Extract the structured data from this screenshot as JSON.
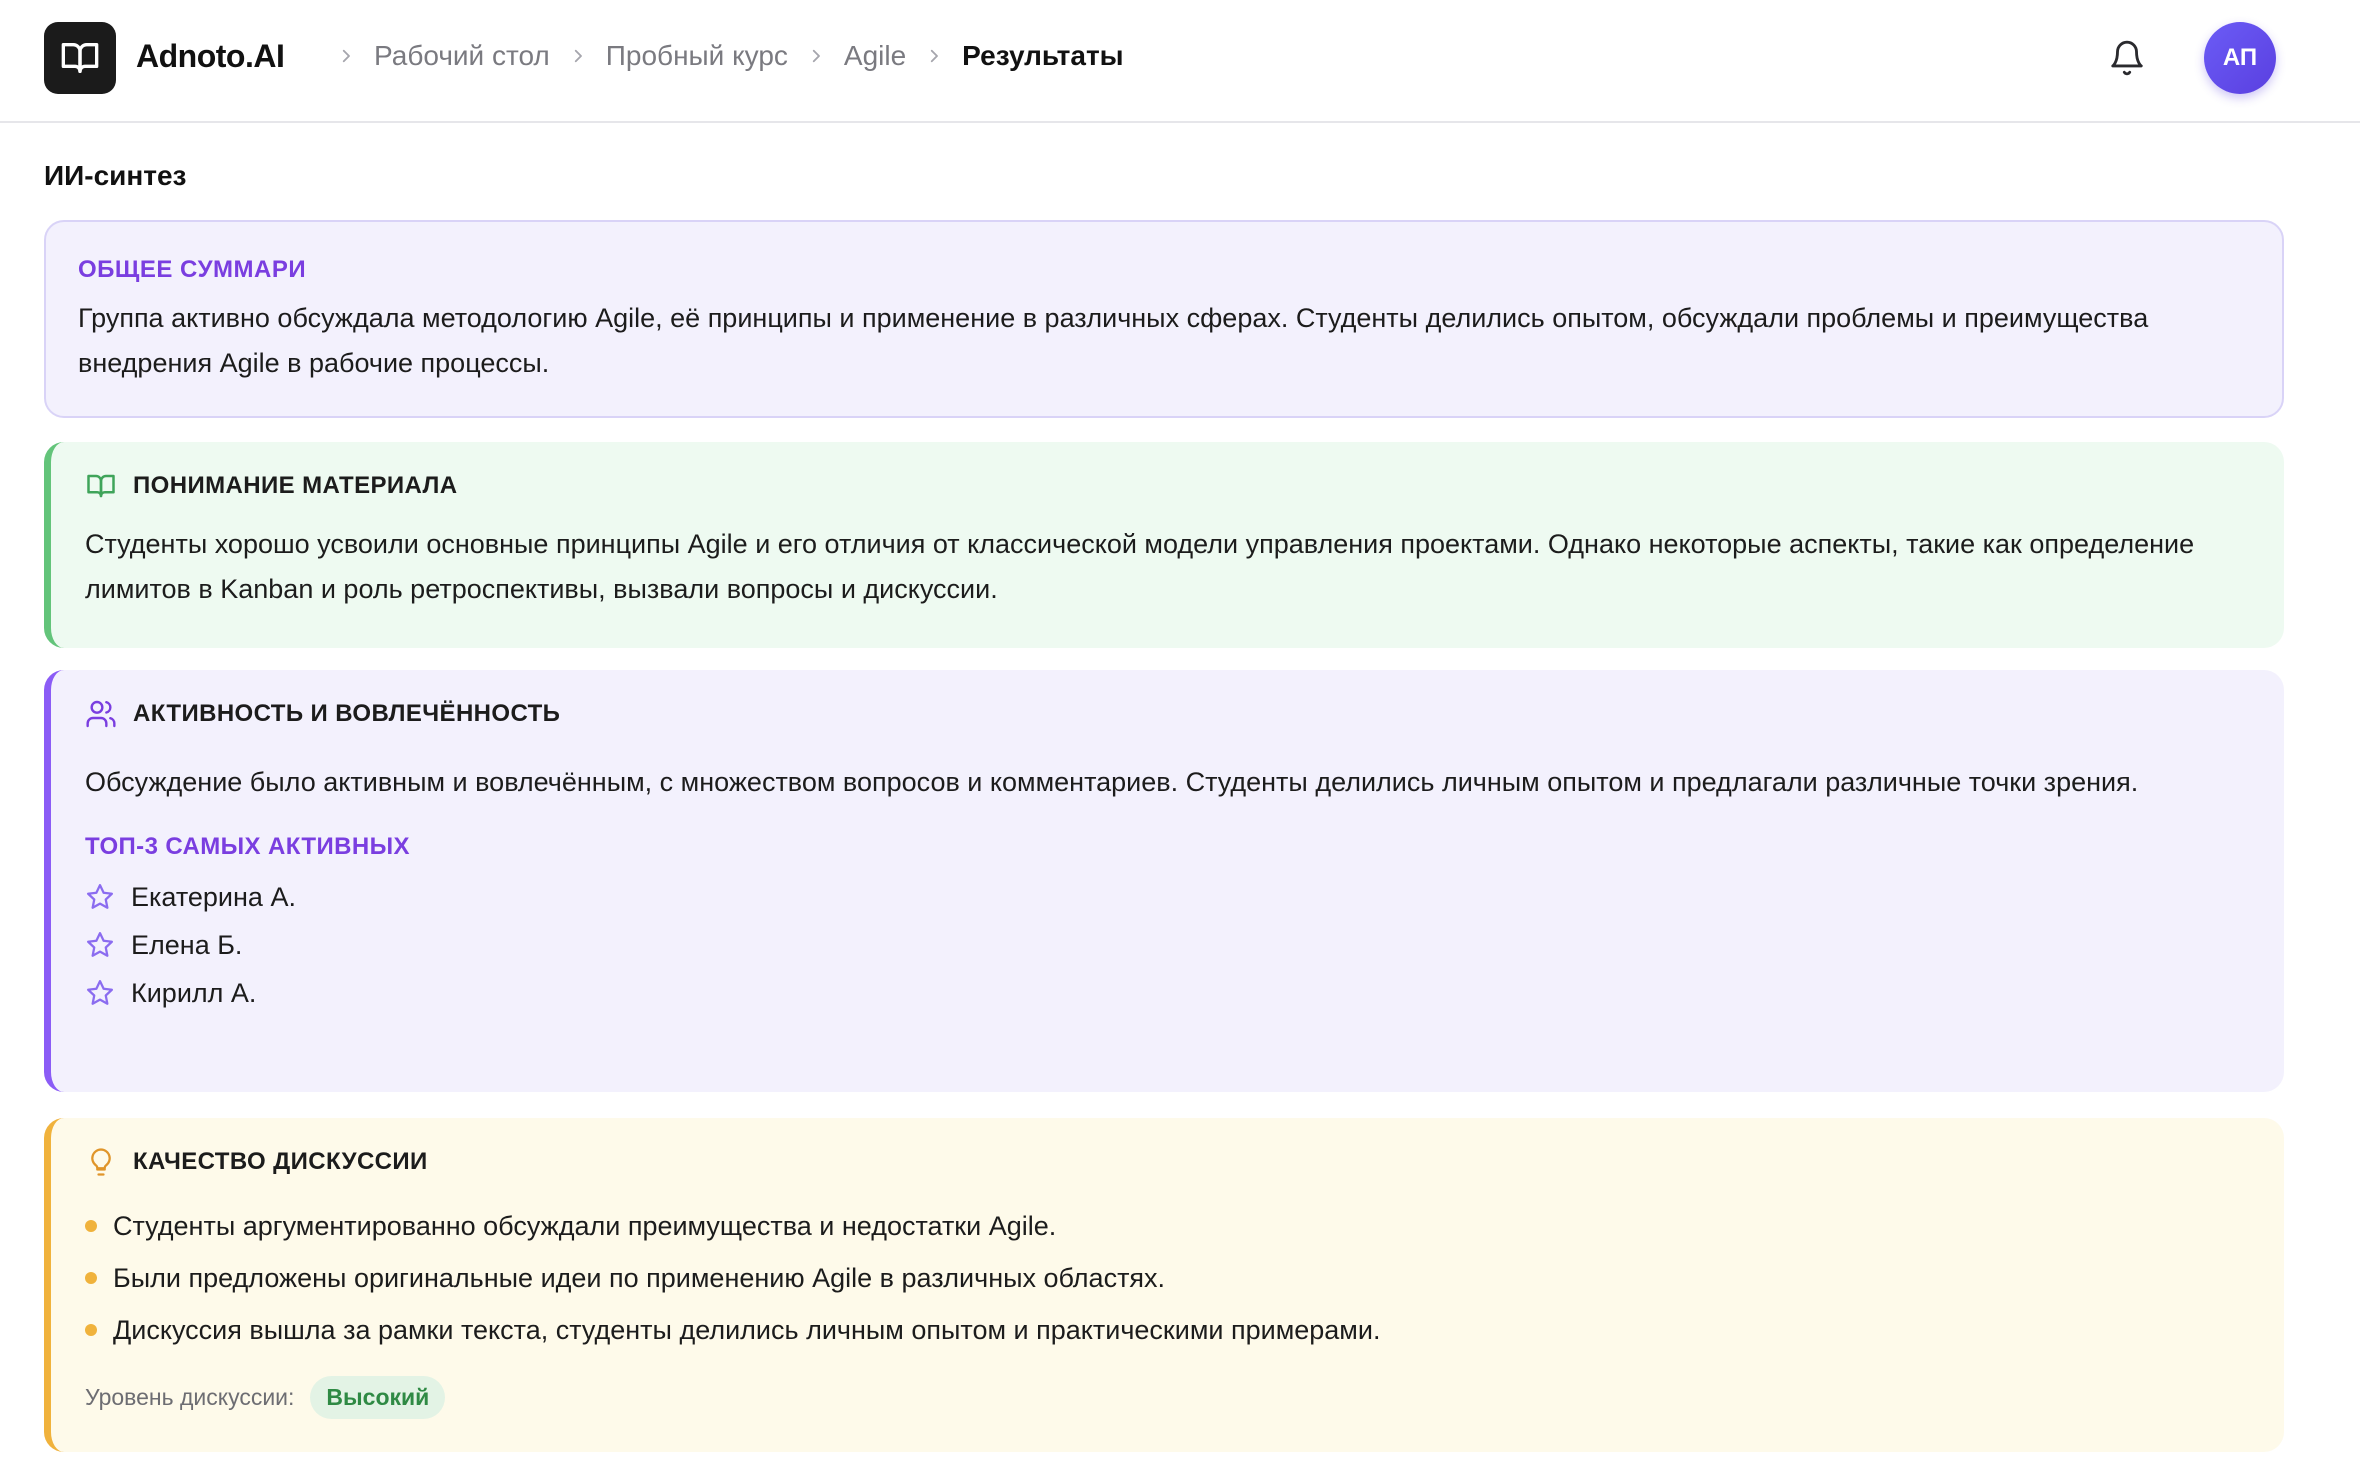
{
  "header": {
    "brand": "Adnoto.AI",
    "breadcrumbs": [
      "Рабочий стол",
      "Пробный курс",
      "Agile",
      "Результаты"
    ],
    "avatar_initials": "АП",
    "icons": {
      "logo": "book-open-icon",
      "notifications": "bell-icon"
    }
  },
  "page": {
    "title": "ИИ-синтез"
  },
  "summary": {
    "label": "ОБЩЕЕ СУММАРИ",
    "text": "Группа активно обсуждала методологию Agile, её принципы и применение в различных сферах. Студенты делились опытом, обсуждали проблемы и преимущества внедрения Agile в рабочие процессы."
  },
  "understanding": {
    "icon": "book-open-icon",
    "title": "ПОНИМАНИЕ МАТЕРИАЛА",
    "text": "Студенты хорошо усвоили основные принципы Agile и его отличия от классической модели управления проектами. Однако некоторые аспекты, такие как определение лимитов в Kanban и роль ретроспективы, вызвали вопросы и дискуссии."
  },
  "activity": {
    "icon": "users-icon",
    "title": "АКТИВНОСТЬ И ВОВЛЕЧЁННОСТЬ",
    "text": "Обсуждение было активным и вовлечённым, с множеством вопросов и комментариев. Студенты делились личным опытом и предлагали различные точки зрения.",
    "top_label": "ТОП-3 САМЫХ АКТИВНЫХ",
    "top": [
      "Екатерина А.",
      "Елена Б.",
      "Кирилл А."
    ]
  },
  "quality": {
    "icon": "lightbulb-icon",
    "title": "КАЧЕСТВО ДИСКУССИИ",
    "points": [
      "Студенты аргументированно обсуждали преимущества и недостатки Agile.",
      "Были предложены оригинальные идеи по применению Agile в различных областях.",
      "Дискуссия вышла за рамки текста, студенты делились личным опытом и практическими примерами."
    ],
    "level_label": "Уровень дискуссии:",
    "level_value": "Высокий"
  },
  "colors": {
    "accent_purple": "#7a3ee0",
    "green": "#63c47a",
    "violet": "#8b5cf6",
    "amber": "#f0b23c",
    "badge_green": "#2f8a44"
  }
}
